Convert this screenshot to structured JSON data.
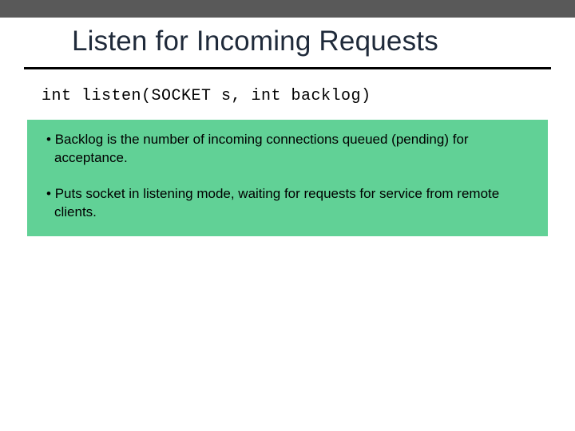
{
  "slide": {
    "title": "Listen for Incoming Requests",
    "code": "int listen(SOCKET s, int backlog)",
    "bullets": [
      "Backlog is the number of incoming connections queued (pending) for acceptance.",
      "Puts socket in listening mode, waiting for requests for service from remote clients."
    ]
  }
}
